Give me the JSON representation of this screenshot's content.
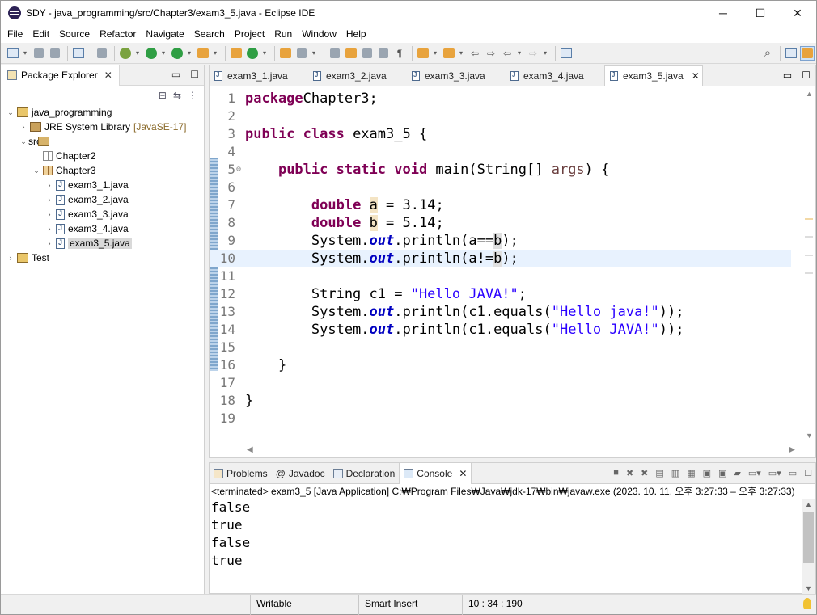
{
  "window": {
    "title": "SDY - java_programming/src/Chapter3/exam3_5.java - Eclipse IDE",
    "minimize": "─",
    "maximize": "☐",
    "close": "✕"
  },
  "menu": [
    "File",
    "Edit",
    "Source",
    "Refactor",
    "Navigate",
    "Search",
    "Project",
    "Run",
    "Window",
    "Help"
  ],
  "package_explorer": {
    "tab_label": "Package Explorer",
    "tree": [
      {
        "indent": 0,
        "twisty": "v",
        "icon": "proj",
        "label": "java_programming",
        "extra": ""
      },
      {
        "indent": 1,
        "twisty": ">",
        "icon": "lib",
        "label": "JRE System Library",
        "extra": "[JavaSE-17]"
      },
      {
        "indent": 1,
        "twisty": "v",
        "icon": "src",
        "label": "src",
        "extra": ""
      },
      {
        "indent": 2,
        "twisty": "",
        "icon": "pkg-empty",
        "label": "Chapter2",
        "extra": ""
      },
      {
        "indent": 2,
        "twisty": "v",
        "icon": "pkg",
        "label": "Chapter3",
        "extra": ""
      },
      {
        "indent": 3,
        "twisty": ">",
        "icon": "java",
        "label": "exam3_1.java",
        "extra": ""
      },
      {
        "indent": 3,
        "twisty": ">",
        "icon": "java",
        "label": "exam3_2.java",
        "extra": ""
      },
      {
        "indent": 3,
        "twisty": ">",
        "icon": "java",
        "label": "exam3_3.java",
        "extra": ""
      },
      {
        "indent": 3,
        "twisty": ">",
        "icon": "java",
        "label": "exam3_4.java",
        "extra": ""
      },
      {
        "indent": 3,
        "twisty": ">",
        "icon": "java",
        "label": "exam3_5.java",
        "extra": "",
        "selected": true
      },
      {
        "indent": 0,
        "twisty": ">",
        "icon": "proj",
        "label": "Test",
        "extra": ""
      }
    ]
  },
  "editor": {
    "tabs": [
      {
        "label": "exam3_1.java",
        "active": false
      },
      {
        "label": "exam3_2.java",
        "active": false
      },
      {
        "label": "exam3_3.java",
        "active": false
      },
      {
        "label": "exam3_4.java",
        "active": false
      },
      {
        "label": "exam3_5.java",
        "active": true
      }
    ],
    "current_line": 10,
    "lines": [
      [
        [
          "kw",
          "package"
        ],
        [
          "",
          "Chapter3;"
        ]
      ],
      [],
      [
        [
          "kw",
          "public class"
        ],
        [
          "",
          " exam3_5 {"
        ]
      ],
      [],
      [
        [
          "",
          "    "
        ],
        [
          "kw",
          "public static void"
        ],
        [
          "",
          " main(String[] "
        ],
        [
          "var",
          "args"
        ],
        [
          "",
          ") {"
        ]
      ],
      [],
      [
        [
          "",
          "        "
        ],
        [
          "kw",
          "double"
        ],
        [
          "",
          " "
        ],
        [
          "hl",
          "a"
        ],
        [
          "",
          " = 3.14;"
        ]
      ],
      [
        [
          "",
          "        "
        ],
        [
          "kw",
          "double"
        ],
        [
          "",
          " "
        ],
        [
          "hl",
          "b"
        ],
        [
          "",
          " = 5.14;"
        ]
      ],
      [
        [
          "",
          "        System."
        ],
        [
          "fld",
          "out"
        ],
        [
          "",
          ".println(a=="
        ],
        [
          "hl2",
          "b"
        ],
        [
          "",
          ");"
        ]
      ],
      [
        [
          "",
          "        System."
        ],
        [
          "fld",
          "out"
        ],
        [
          "",
          ".println(a!="
        ],
        [
          "hl2",
          "b"
        ],
        [
          "",
          ");"
        ],
        [
          "caret",
          ""
        ]
      ],
      [],
      [
        [
          "",
          "        String c1 = "
        ],
        [
          "str",
          "\"Hello JAVA!\""
        ],
        [
          "",
          ";"
        ]
      ],
      [
        [
          "",
          "        System."
        ],
        [
          "fld",
          "out"
        ],
        [
          "",
          ".println(c1.equals("
        ],
        [
          "str",
          "\"Hello java!\""
        ],
        [
          "",
          "));"
        ]
      ],
      [
        [
          "",
          "        System."
        ],
        [
          "fld",
          "out"
        ],
        [
          "",
          ".println(c1.equals("
        ],
        [
          "str",
          "\"Hello JAVA!\""
        ],
        [
          "",
          "));"
        ]
      ],
      [],
      [
        [
          "",
          "    }"
        ]
      ],
      [],
      [
        [
          "",
          "}"
        ]
      ],
      []
    ]
  },
  "console": {
    "tabs": [
      "Problems",
      "Javadoc",
      "Declaration",
      "Console"
    ],
    "active_tab": "Console",
    "status": "<terminated> exam3_5 [Java Application] C:₩Program Files₩Java₩jdk-17₩bin₩javaw.exe  (2023. 10. 11. 오후 3:27:33 – 오후 3:27:33)",
    "output": [
      "false",
      "true",
      "false",
      "true"
    ]
  },
  "statusbar": {
    "writable": "Writable",
    "insert_mode": "Smart Insert",
    "position": "10 : 34 : 190"
  }
}
